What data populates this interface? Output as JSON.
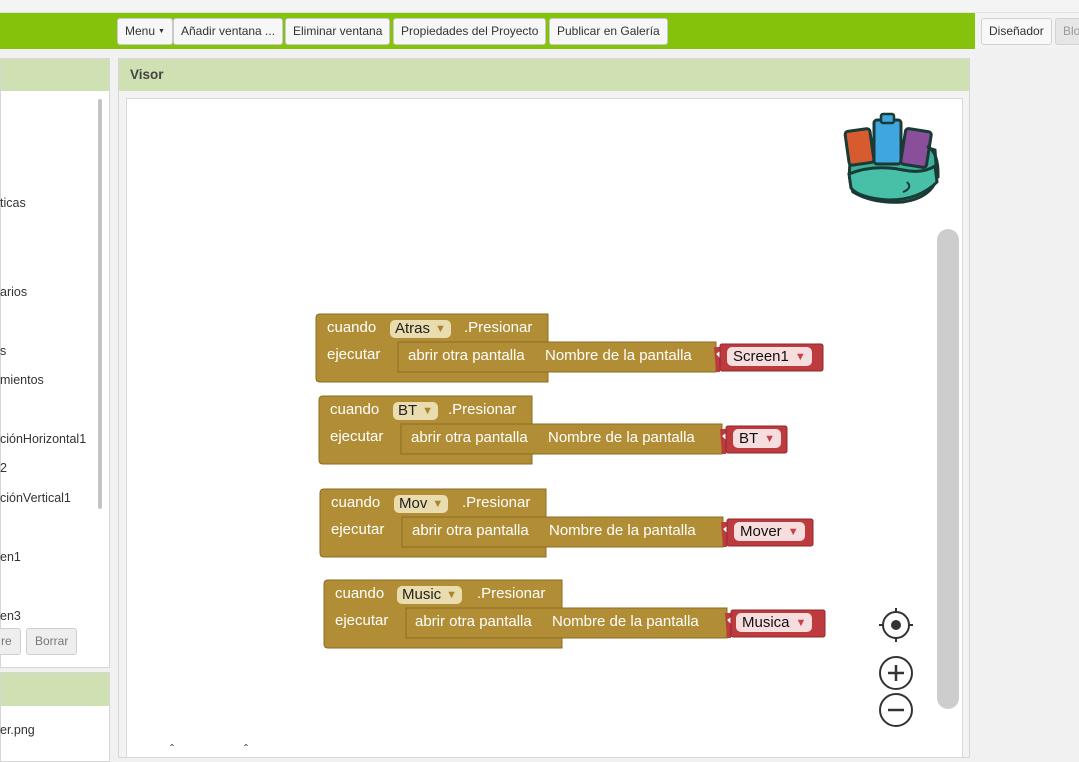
{
  "toolbar": {
    "menu_label": "Menu",
    "add_screen_label": "Añadir ventana ...",
    "remove_screen_label": "Eliminar ventana",
    "project_props_label": "Propiedades del Proyecto",
    "publish_label": "Publicar en Galería",
    "designer_label": "Diseñador",
    "blocks_label": "Blo"
  },
  "left_panel": {
    "items": [
      "ticas",
      "arios",
      "s",
      "mientos",
      "ciónHorizontal1",
      "2",
      "ciónVertical1",
      "en1",
      "en3"
    ],
    "rename_label": "re",
    "delete_label": "Borrar",
    "media_item": "er.png"
  },
  "visor": {
    "title": "Visor"
  },
  "blocks": [
    {
      "when": "cuando",
      "component": "Atras",
      "event": ".Presionar",
      "do": "ejecutar",
      "action": "abrir otra pantalla",
      "param": "Nombre de la pantalla",
      "screen": "Screen1"
    },
    {
      "when": "cuando",
      "component": "BT",
      "event": ".Presionar",
      "do": "ejecutar",
      "action": "abrir otra pantalla",
      "param": "Nombre de la pantalla",
      "screen": "BT"
    },
    {
      "when": "cuando",
      "component": "Mov",
      "event": ".Presionar",
      "do": "ejecutar",
      "action": "abrir otra pantalla",
      "param": "Nombre de la pantalla",
      "screen": "Mover"
    },
    {
      "when": "cuando",
      "component": "Music",
      "event": ".Presionar",
      "do": "ejecutar",
      "action": "abrir otra pantalla",
      "param": "Nombre de la pantalla",
      "screen": "Musica"
    }
  ],
  "workspace_controls": {
    "center": "crosshair-icon",
    "zoom_in": "zoom-in-icon",
    "zoom_out": "zoom-out-icon",
    "backpack": "backpack-icon"
  },
  "colors": {
    "toolbar_green": "#84c20c",
    "header_green": "#cfe0b3",
    "event_block": "#b18e35",
    "text_block": "#bd3a3f"
  }
}
